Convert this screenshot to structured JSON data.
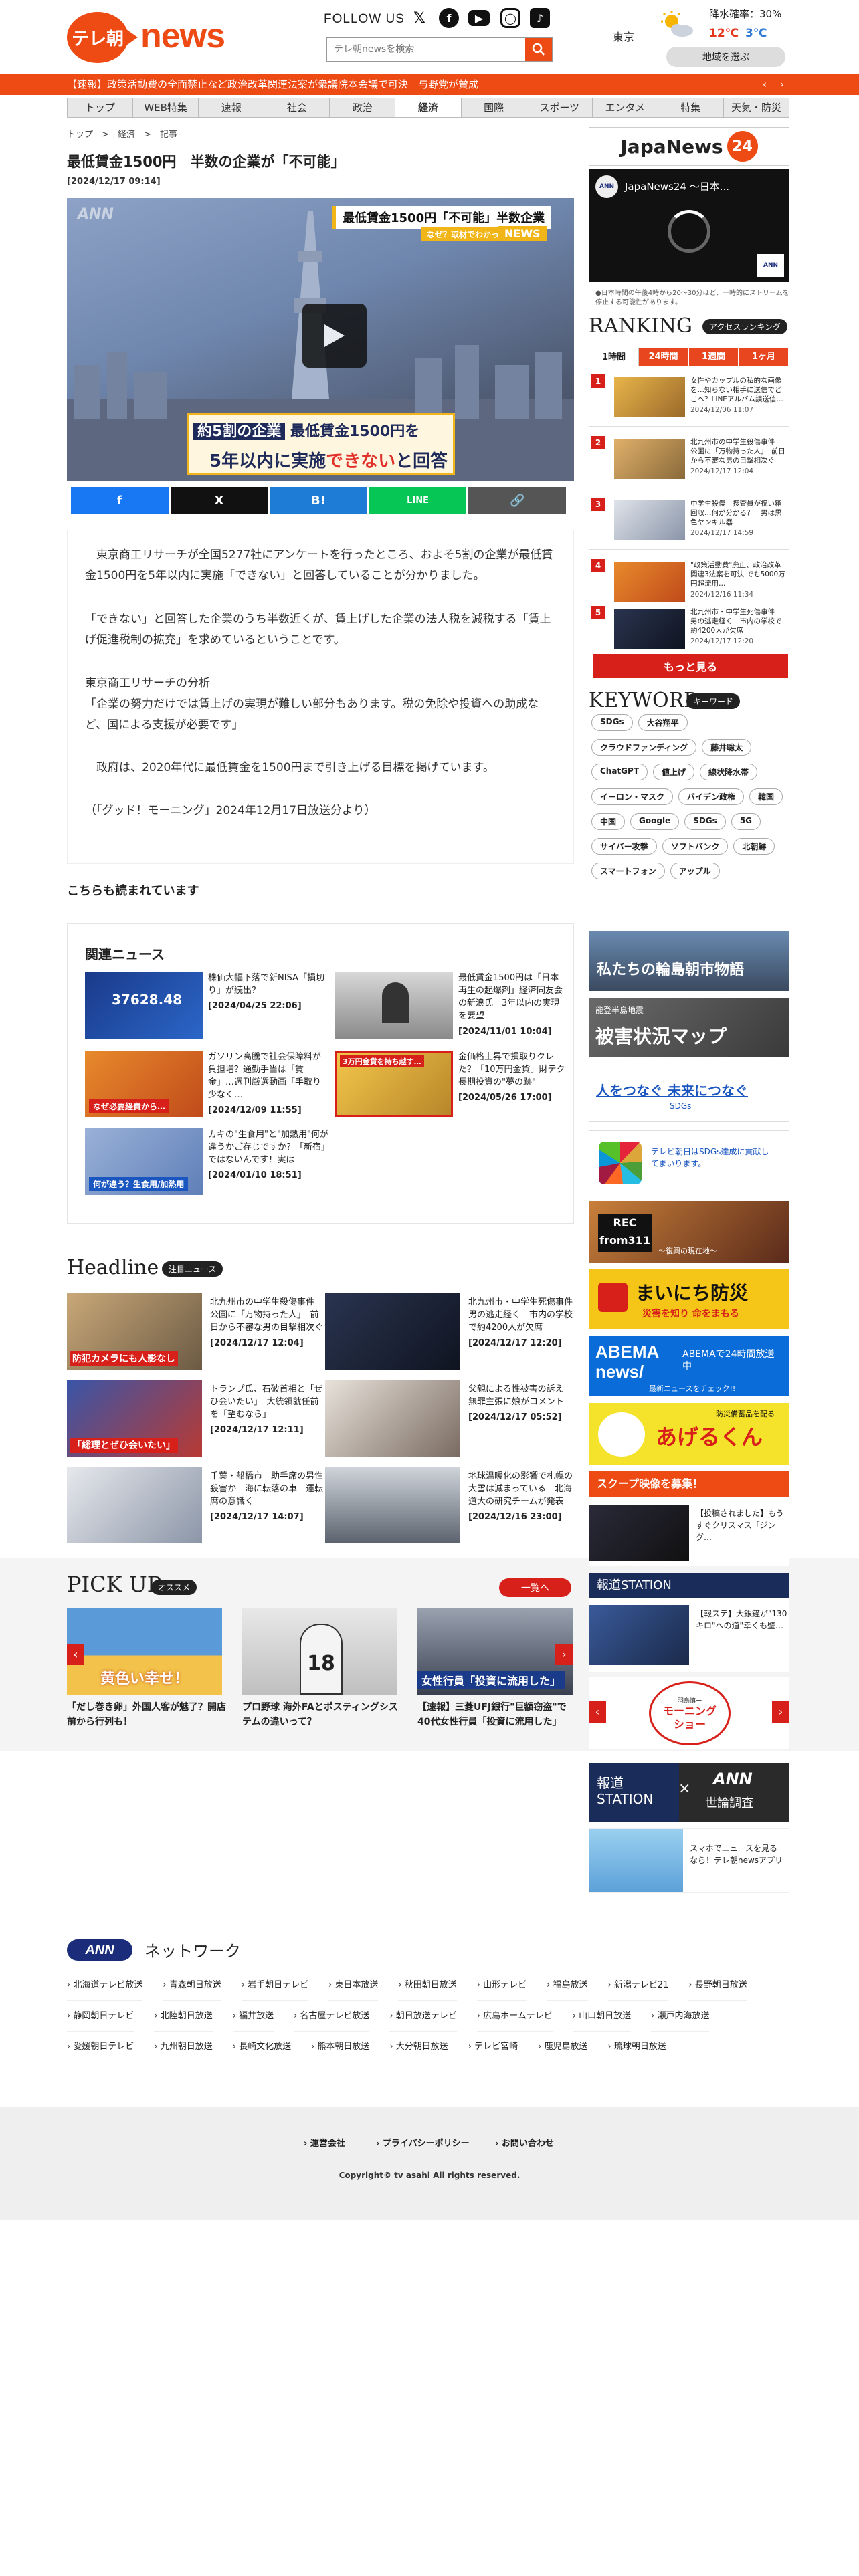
{
  "header": {
    "logo_ball": "テレ朝",
    "logo_news": "news",
    "follow_label": "FOLLOW US",
    "search_placeholder": "テレ朝newsを検索",
    "weather": {
      "place": "東京",
      "rain": "降水確率：30%",
      "high": "12℃",
      "low": "3℃",
      "select_label": "地域を選ぶ"
    },
    "ticker": "【速報】政策活動費の全面禁止など政治改革関連法案が衆議院本会議で可決　与野党が賛成",
    "ticker_prev": "‹",
    "ticker_next": "›"
  },
  "nav": [
    "トップ",
    "WEB特集",
    "速報",
    "社会",
    "政治",
    "経済",
    "国際",
    "スポーツ",
    "エンタメ",
    "特集",
    "天気・防災"
  ],
  "nav_active": "経済",
  "breadcrumb": [
    "トップ",
    "経済",
    "記事"
  ],
  "article": {
    "title": "最低賃金1500円　半数の企業が「不可能」",
    "date": "[2024/12/17 09:14]",
    "video": {
      "ann_mark": "ANN",
      "top_caption": "最低賃金1500円「不可能」半数企業",
      "top_sub": "なぜ？取材でわかった",
      "news_tag": "NEWS",
      "lower_line1_a": "約5割の企業",
      "lower_line1_b": "最低賃金1500円を",
      "lower_line2_a": "5年以内に実施",
      "lower_line2_b": "できない",
      "lower_line2_c": "と回答"
    },
    "share": [
      "f",
      "X",
      "B!",
      "LINE",
      "🔗"
    ],
    "paragraphs": [
      "　東京商工リサーチが全国5277社にアンケートを行ったところ、およそ5割の企業が最低賃金1500円を5年以内に実施「できない」と回答していることが分かりました。",
      "「できない」と回答した企業のうち半数近くが、賃上げした企業の法人税を減税する「賃上げ促進税制の拡充」を求めているということです。",
      "東京商工リサーチの分析\n「企業の努力だけでは賃上げの実現が難しい部分もあります。税の免除や投資への助成など、国による支援が必要です」",
      "　政府は、2020年代に最低賃金を1500円まで引き上げる目標を掲げています。",
      "（「グッド！モーニング」2024年12月17日放送分より）"
    ]
  },
  "also_read": "こちらも読まれています",
  "related": {
    "title": "関連ニュース",
    "items": [
      {
        "text": "株価大幅下落で新NISA「損切り」が続出？",
        "date": "[2024/04/25 22:06]",
        "label": "37628.48"
      },
      {
        "text": "最低賃金1500円は「日本再生の起爆剤」経済同友会の新浪氏　3年以内の実現を要望",
        "date": "[2024/11/01 10:04]",
        "label": ""
      },
      {
        "text": "ガソリン高騰で社会保障料が負担増？通勤手当は「賃金」…週刊厳選動画「手取り少なく…",
        "date": "[2024/12/09 11:55]",
        "label": "なぜ必要経費から…"
      },
      {
        "text": "金価格上昇で損取りクレた？「10万円金貨」財テク長期投資の\"夢の跡\"",
        "date": "[2024/05/26 17:00]",
        "label": "3万円金貨を持ち越す…"
      },
      {
        "text": "カキの\"生食用\"と\"加熱用\"何が違うかご存じですか？「新宿」ではないんです！実は",
        "date": "[2024/01/10 18:51]",
        "label": "何が違う？生食用/加熱用"
      }
    ]
  },
  "headline": {
    "title": "Headline",
    "badge": "注目ニュース",
    "items": [
      {
        "text": "北九州市の中学生殺傷事件　公園に「万物持った人」　前日から不審な男の目撃相次ぐ",
        "date": "[2024/12/17 12:04]",
        "label": "防犯カメラにも人影なし"
      },
      {
        "text": "北九州市・中学生死傷事件　男の逃走経く　市内の学校で約4200人が欠席",
        "date": "[2024/12/17 12:20]",
        "label": ""
      },
      {
        "text": "トランプ氏、石破首相と「ぜひ会いたい」　大統領就任前を「望むなら」",
        "date": "[2024/12/17 12:11]",
        "label": "「総理とぜひ会いたい」"
      },
      {
        "text": "父親による性被害の訴え　無罪主張に娘がコメント",
        "date": "[2024/12/17 05:52]",
        "label": ""
      },
      {
        "text": "千葉・船橋市　助手席の男性殺害か　海に転落の車　運転席の意識く",
        "date": "[2024/12/17 14:07]",
        "label": ""
      },
      {
        "text": "地球温暖化の影響で札幌の大雪は減まっている　北海道大の研究チームが発表",
        "date": "[2024/12/16 23:00]",
        "label": ""
      }
    ]
  },
  "pickup": {
    "title": "PICK UP",
    "badge": "オススメ",
    "more": "一覧へ",
    "items": [
      {
        "caption": "「だし巻き卵」外国人客が魅了？開店前から行列も！",
        "label": "黄色い幸せ！"
      },
      {
        "caption": "プロ野球 海外FAとポスティングシステムの違いって？",
        "label": "18"
      },
      {
        "caption": "【速報】三菱UFJ銀行\"巨額窃盗\"で40代女性行員「投資に流用した」",
        "label": "女性行員「投資に流用した」"
      }
    ]
  },
  "sidebar": {
    "japanews": "JapaNews",
    "japanews_num": "24",
    "video_title": "JapaNews24 ～日本...",
    "video_note": "●日本時間の午後4時から20～30分ほど、一時的にストリームを停止する可能性があります。",
    "ranking_title": "RANKING",
    "ranking_badge": "アクセスランキング",
    "ranking_tabs": [
      "1時間",
      "24時間",
      "1週間",
      "1ヶ月"
    ],
    "ranking": [
      {
        "no": "1",
        "text": "女性やカップルの私的な画像を…知らない相手に送信でどこへ？LINEアルバム誤送信…",
        "date": "2024/12/06 11:07"
      },
      {
        "no": "2",
        "text": "北九州市の中学生殺傷事件　公園に「万物持った人」　前日から不審な男の目撃相次ぐ",
        "date": "2024/12/17 12:04"
      },
      {
        "no": "3",
        "text": "中学生殺傷　捜査員が祝い箱回収…何が分かる？　男は黒色ヤンキル器",
        "date": "2024/12/17 14:59"
      },
      {
        "no": "4",
        "text": "\"政策活動費\"廃止、政治改革関連3法案を可決 でも5000万円超流用…",
        "date": "2024/12/16 11:34"
      },
      {
        "no": "5",
        "text": "北九州市・中学生死傷事件　男の逃走経く　市内の学校で約4200人が欠席",
        "date": "2024/12/17 12:20"
      }
    ],
    "more_label": "もっと見る",
    "keyword_title": "KEYWORD",
    "keyword_badge": "キーワード",
    "keywords": [
      "SDGs",
      "大谷翔平",
      "クラウドファンディング",
      "藤井聡太",
      "ChatGPT",
      "値上げ",
      "線状降水帯",
      "イーロン・マスク",
      "バイデン政権",
      "韓国",
      "中国",
      "Google",
      "SDGs",
      "5G",
      "サイバー攻撃",
      "ソフトバンク",
      "北朝鮮",
      "スマートフォン",
      "アップル"
    ],
    "banners": {
      "wajima": "私たちの輪島朝市物語",
      "map_small": "能登半島地震",
      "map": "被害状況マップ",
      "sdgs": "人をつなぐ 未来につなぐ",
      "sdgs_sub": "SDGs",
      "sdgs2": "テレビ朝日はSDGs達成に貢献してまいります。",
      "rec311": "REC from311",
      "rec311_sub": "～復興の現在地～",
      "bousai": "まいにち防災",
      "bousai_sub": "災害を知り 命をまもる",
      "abema": "ABEMA news/",
      "abema_sub": "ABEMAで24時間放送中",
      "abema_sub2": "最新ニュースをチェック!!",
      "ageru": "あげるくん",
      "ageru_sub": "防災備蓄品を配る",
      "scoop": "スクープ映像を募集！",
      "scoop_text": "【投稿されました】もうすぐクリスマス「ジング…",
      "hodo": "報道STATION",
      "hodo_text": "【報ステ】大銀鐘が\"130キロ\"への道\"幸くも壁…",
      "morning": "モーニングショー",
      "morning_sub": "羽鳥慎一",
      "poll1": "報道STATION",
      "poll2": "ANN",
      "poll3": "世論調査",
      "app_text": "スマホでニュースを見るなら！テレ朝newsアプリ"
    }
  },
  "network": {
    "ann": "ANN",
    "title": "ネットワーク",
    "stations": [
      "北海道テレビ放送",
      "青森朝日放送",
      "岩手朝日テレビ",
      "東日本放送",
      "秋田朝日放送",
      "山形テレビ",
      "福島放送",
      "新潟テレビ21",
      "長野朝日放送",
      "静岡朝日テレビ",
      "北陸朝日放送",
      "福井放送",
      "名古屋テレビ放送",
      "朝日放送テレビ",
      "広島ホームテレビ",
      "山口朝日放送",
      "瀬戸内海放送",
      "愛媛朝日テレビ",
      "九州朝日放送",
      "長崎文化放送",
      "熊本朝日放送",
      "大分朝日放送",
      "テレビ宮崎",
      "鹿児島放送",
      "琉球朝日放送"
    ]
  },
  "footer": {
    "links": [
      "運営会社",
      "プライバシーポリシー",
      "お問い合わせ"
    ],
    "copyright": "Copyright© tv asahi All rights reserved."
  },
  "colors": {
    "brand": "#ee4a14",
    "accent": "#d8201a",
    "ticker": "#ee4a14"
  },
  "icons": [
    "x-icon",
    "facebook-icon",
    "youtube-icon",
    "instagram-icon",
    "tiktok-icon",
    "search-icon",
    "play-icon",
    "sun-cloud-icon"
  ]
}
